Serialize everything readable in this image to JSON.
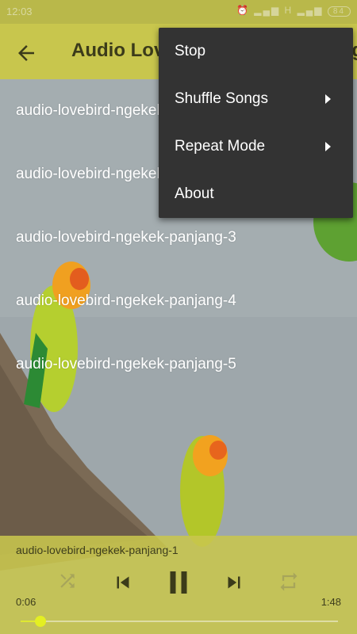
{
  "status_bar": {
    "time": "12:03",
    "signal": "H",
    "battery": "84"
  },
  "app_bar": {
    "title": "Audio Lovebird Ngekek Panjang"
  },
  "playlist": [
    "audio-lovebird-ngekek-panjang-1",
    "audio-lovebird-ngekek-panjang-2",
    "audio-lovebird-ngekek-panjang-3",
    "audio-lovebird-ngekek-panjang-4",
    "audio-lovebird-ngekek-panjang-5"
  ],
  "menu": {
    "stop": "Stop",
    "shuffle": "Shuffle Songs",
    "repeat": "Repeat Mode",
    "about": "About"
  },
  "player": {
    "track": "audio-lovebird-ngekek-panjang-1",
    "current_time": "0:06",
    "total_time": "1:48",
    "progress": 0.063
  },
  "colors": {
    "accent": "#c8c64d",
    "menu_bg": "#333333",
    "seek": "#e4ef22"
  }
}
